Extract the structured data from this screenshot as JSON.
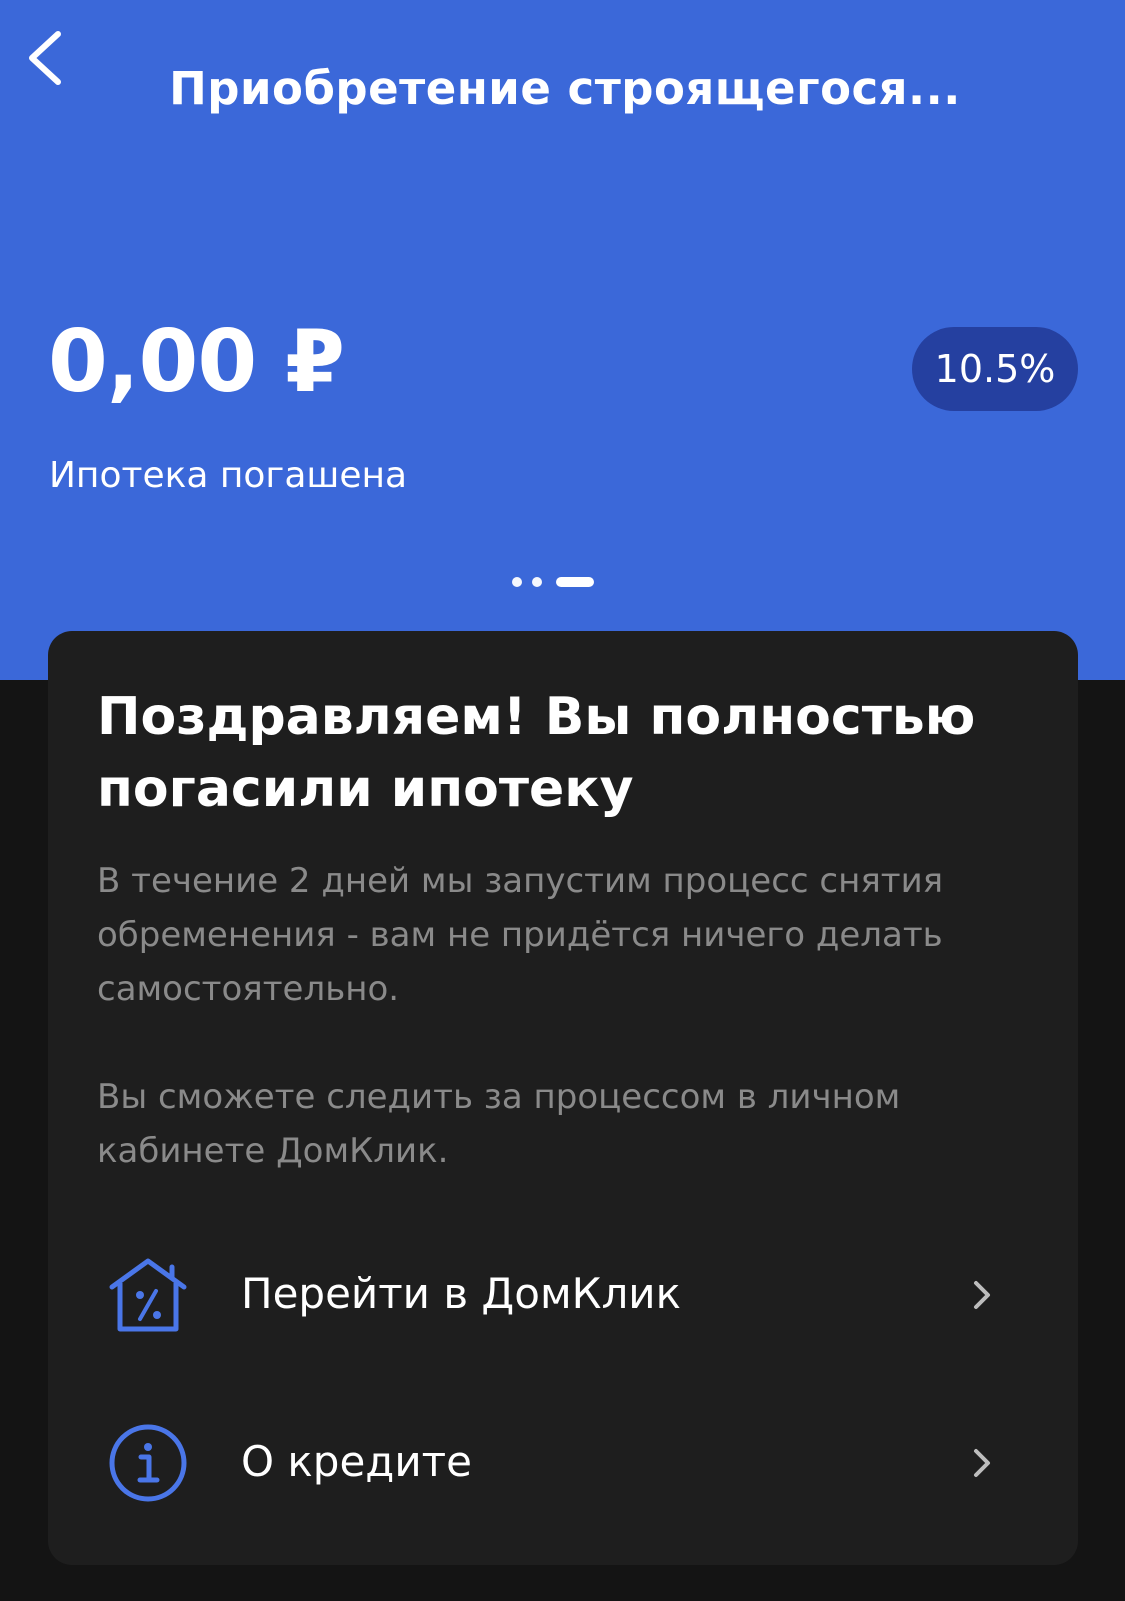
{
  "header": {
    "back_icon": "chevron-left-icon",
    "title": "Приобретение строящегося...",
    "balance": "0,00 ₽",
    "rate": "10.5%",
    "status": "Ипотека погашена",
    "pager": {
      "total": 3,
      "active": 3
    },
    "background_color": "#3b68d9"
  },
  "card": {
    "heading": "Поздравляем! Вы полностью погасили ипотеку",
    "paragraph1": "В течение 2 дней мы запустим процесс снятия обременения - вам не придётся ничего делать самостоятельно.",
    "paragraph2": "Вы сможете следить за процессом в личном кабинете ДомКлик.",
    "actions": [
      {
        "label": "Перейти в ДомКлик",
        "icon": "house-percent-icon",
        "trailing_icon": "chevron-right-icon"
      },
      {
        "label": "О кредите",
        "icon": "info-icon",
        "trailing_icon": "chevron-right-icon"
      }
    ],
    "accent_color": "#4a76e8"
  }
}
